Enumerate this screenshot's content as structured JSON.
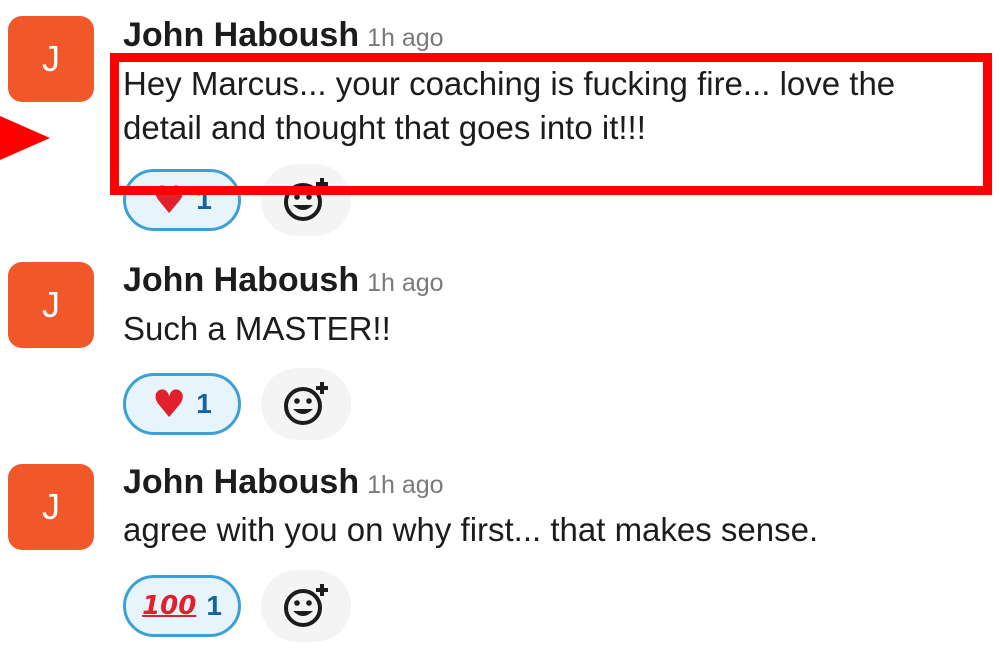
{
  "colors": {
    "avatar_bg": "#f0582a",
    "highlight": "#ff0000",
    "reaction_border": "#3ca0d6",
    "reaction_bg": "#e8f4fb",
    "reaction_count": "#1264a3"
  },
  "messages": [
    {
      "avatar_initial": "J",
      "author": "John Haboush",
      "time": "1h ago",
      "lines": [
        "Hey Marcus... your coaching is fucking fire... love the",
        "detail and thought that goes into it!!!"
      ],
      "reaction": {
        "emoji": "heart-emoji",
        "count": "1"
      },
      "add_reaction_icon": "add-reaction-icon"
    },
    {
      "avatar_initial": "J",
      "author": "John Haboush",
      "time": "1h ago",
      "lines": [
        "Such a MASTER!!"
      ],
      "reaction": {
        "emoji": "heart-emoji",
        "count": "1"
      },
      "add_reaction_icon": "add-reaction-icon"
    },
    {
      "avatar_initial": "J",
      "author": "John Haboush",
      "time": "1h ago",
      "lines": [
        "agree with you on why first... that makes sense."
      ],
      "reaction": {
        "emoji": "hundred-points-emoji",
        "glyph": "100",
        "count": "1"
      },
      "add_reaction_icon": "add-reaction-icon"
    }
  ],
  "annotation": {
    "highlighted_message_index": 0,
    "pointer": "red-arrow-icon"
  }
}
